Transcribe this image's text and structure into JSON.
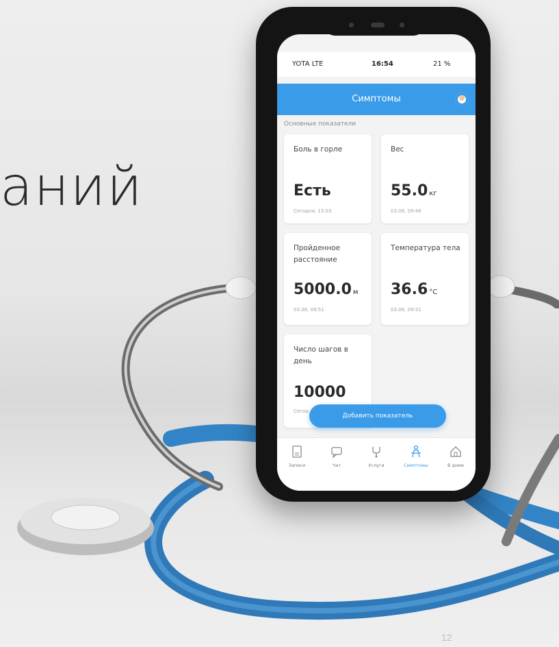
{
  "slide": {
    "heading": "аний",
    "page_number": "12"
  },
  "phone": {
    "status": {
      "carrier": "YOTA  LTE",
      "time": "16:54",
      "battery": "21 %"
    },
    "appbar_title": "Симптомы",
    "section_label": "Основные показатели",
    "cards": [
      {
        "title": "Боль в горле",
        "value": "Есть",
        "unit": "",
        "date": "Сегодня, 13:03"
      },
      {
        "title": "Вес",
        "value": "55.0",
        "unit": "кг",
        "date": "03.08, 09:46"
      },
      {
        "title": "Пройденное расстояние",
        "value": "5000.0",
        "unit": "м",
        "date": "03.08, 09:51"
      },
      {
        "title": "Температура тела",
        "value": "36.6",
        "unit": "°C",
        "date": "03.08, 09:51"
      },
      {
        "title": "Число шагов в день",
        "value": "10000",
        "unit": "",
        "date": "Сегод"
      }
    ],
    "add_button": "Добавить показатель",
    "tabs": [
      {
        "label": "Записи",
        "icon": "notes-icon"
      },
      {
        "label": "Чат",
        "icon": "chat-icon"
      },
      {
        "label": "Услуги",
        "icon": "services-icon"
      },
      {
        "label": "Симптомы",
        "icon": "symptoms-icon"
      },
      {
        "label": "В доме",
        "icon": "home-icon"
      }
    ],
    "accent_color": "#3a9be8"
  }
}
